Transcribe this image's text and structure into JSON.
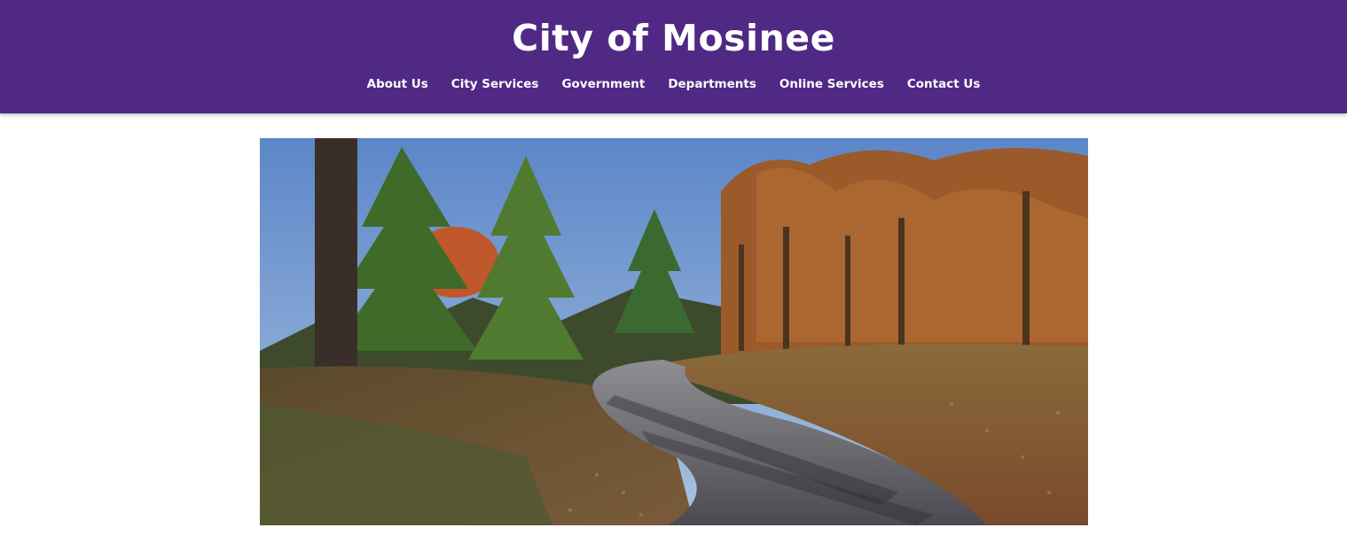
{
  "header": {
    "site_title": "City of Mosinee",
    "background_color": "#4f2984",
    "text_color": "#ffffff"
  },
  "nav": {
    "items": [
      {
        "label": "About Us"
      },
      {
        "label": "City Services"
      },
      {
        "label": "Government"
      },
      {
        "label": "Departments"
      },
      {
        "label": "Online Services"
      },
      {
        "label": "Contact Us"
      }
    ]
  },
  "hero": {
    "image": "autumn-trail-photo"
  }
}
